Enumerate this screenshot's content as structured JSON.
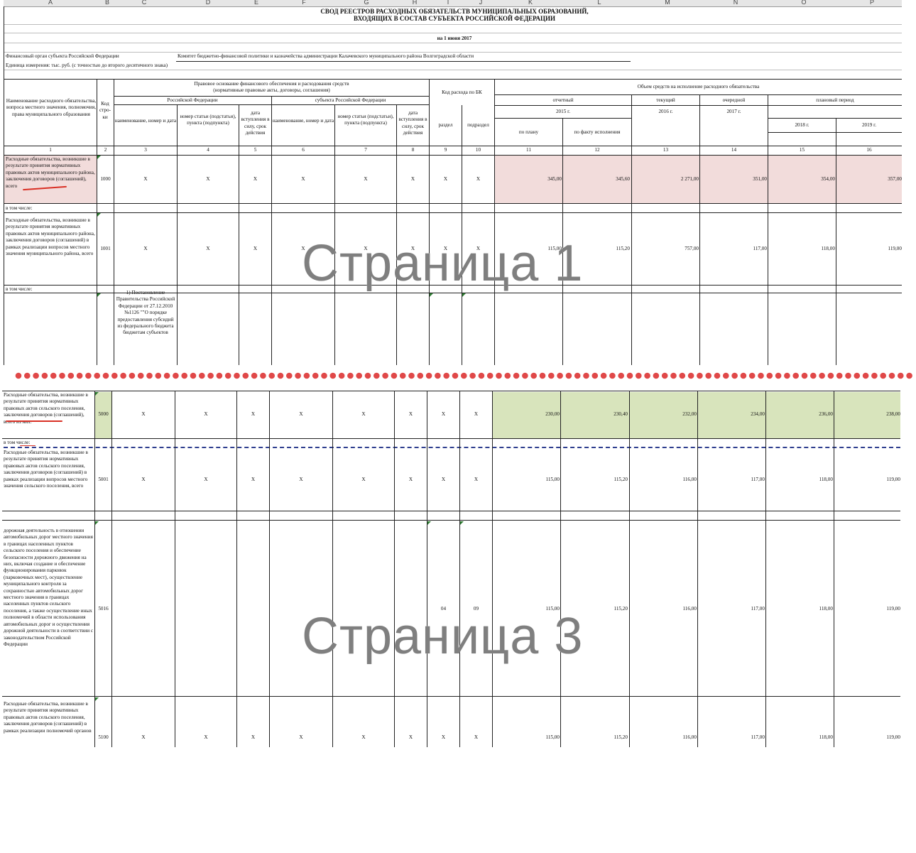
{
  "columns": [
    "A",
    "B",
    "C",
    "D",
    "E",
    "F",
    "G",
    "H",
    "I",
    "J",
    "K",
    "L",
    "M",
    "N",
    "O",
    "P"
  ],
  "title": {
    "line1": "СВОД РЕЕСТРОВ РАСХОДНЫХ ОБЯЗАТЕЛЬСТВ МУНИЦИПАЛЬНЫХ ОБРАЗОВАНИЙ,",
    "line2": "ВХОДЯЩИХ В СОСТАВ СУБЪЕКТА РОССИЙСКОЙ ФЕДЕРАЦИИ",
    "date": "на 1 июня 2017"
  },
  "info": {
    "organ_label": "Финансовый орган субъекта Российской Федерации",
    "organ_value": "Комитет бюджетно-финансовой политики и казначейства администрации Калачевского муниципального района Волгоградской области",
    "units": "Единица измерения: тыс. руб. (с точностью до второго десятичного знака)"
  },
  "header": {
    "name_col": "Наименование расходного обязательства, вопроса местного значения, полномочия, права муниципального образования",
    "code_col": "Код стро-ки",
    "legal_basis": "Правовое основание финансового обеспечения и расходования средств (нормативные правовые акты, договоры, соглашения)",
    "rf": "Российской Федерации",
    "subject_rf": "субъекта Российской Федерации",
    "act_name": "наименование, номер и дата",
    "article": "номер статьи (подстатьи), пункта (подпункта)",
    "date_in_force": "дата вступления в силу, срок действия",
    "bk_code": "Код расхода по БК",
    "section": "раздел",
    "subsection": "подраздел",
    "volume": "Объем средств на исполнение расходного обязательства",
    "reporting": "отчетный",
    "current": "текущий",
    "next": "очередной",
    "planned": "плановый период",
    "y2015": "2015 г.",
    "y2016": "2016 г.",
    "y2017": "2017 г.",
    "y2018": "2018 г.",
    "y2019": "2019 г.",
    "by_plan": "по плану",
    "by_fact": "по факту исполнения",
    "nums": [
      "1",
      "2",
      "3",
      "4",
      "5",
      "6",
      "7",
      "8",
      "9",
      "10",
      "11",
      "12",
      "13",
      "14",
      "15",
      "16"
    ]
  },
  "page1": {
    "row1000": {
      "name": "Расходные обязательства, возникшие в результате принятия нормативных правовых актов муниципального района, заключения договоров (соглашений), всего",
      "code": "1000",
      "x": "X",
      "values": [
        "345,00",
        "345,60",
        "2 271,00",
        "351,00",
        "354,00",
        "357,00"
      ]
    },
    "incl1": "в том числе:",
    "row1001": {
      "name": "Расходные обязательства, возникшие в результате принятия нормативных правовых актов муниципального района, заключения договоров (соглашений) в рамках реализации вопросов местного значения муниципального района, всего",
      "code": "1001",
      "values": [
        "115,00",
        "115,20",
        "757,00",
        "117,00",
        "118,00",
        "119,00"
      ]
    },
    "incl2": "в том числе:",
    "act_text": "1) Постановление Правительства Российской Федерации от 27.12.2010 №1126 \"\"О порядке предоставления субсидий из федерального бюджета бюджетам субъектов",
    "watermark": "Страница 1"
  },
  "page3": {
    "row5000": {
      "name": "Расходные обязательства, возникшие в результате принятия нормативных правовых актов сельского поселения, заключения договоров (соглашений), всего из них:",
      "code": "5000",
      "values": [
        "230,00",
        "230,40",
        "232,00",
        "234,00",
        "236,00",
        "238,00"
      ]
    },
    "incl": "в том числе:",
    "row5001": {
      "name": "Расходные обязательства, возникшие в результате принятия нормативных правовых актов сельского поселения, заключения договоров (соглашений) в рамках реализации вопросов местного значения сельского поселения, всего",
      "code": "5001",
      "values": [
        "115,00",
        "115,20",
        "116,00",
        "117,00",
        "118,00",
        "119,00"
      ]
    },
    "row5016": {
      "name": "дорожная деятельность в отношении автомобильных дорог местного значения в границах населенных пунктов сельского поселения и обеспечение безопасности дорожного движения на них, включая создание и обеспечение функционирования парковок (парковочных мест), осуществление муниципального контроля за сохранностью автомобильных дорог местного значения в границах населенных пунктов сельского поселения, а также осуществление иных полномочий в области использования автомобильных дорог и осуществления дорожной деятельности в соответствии с законодательством Российской Федерации",
      "code": "5016",
      "section": "04",
      "subsection": "09",
      "values": [
        "115,00",
        "115,20",
        "116,00",
        "117,00",
        "118,00",
        "119,00"
      ]
    },
    "row5100": {
      "name": "Расходные обязательства, возникшие в результате принятия нормативных правовых актов сельского поселения, заключения договоров (соглашений) в рамках реализации полномочий органов",
      "code": "5100",
      "values": [
        "115,00",
        "115,20",
        "116,00",
        "117,00",
        "118,00",
        "119,00"
      ]
    },
    "watermark": "Страница 3"
  },
  "colors": {
    "pink": "#f2dcdb",
    "green": "#d8e4bc",
    "red_dot": "#e04848",
    "underline": "#d93025"
  }
}
